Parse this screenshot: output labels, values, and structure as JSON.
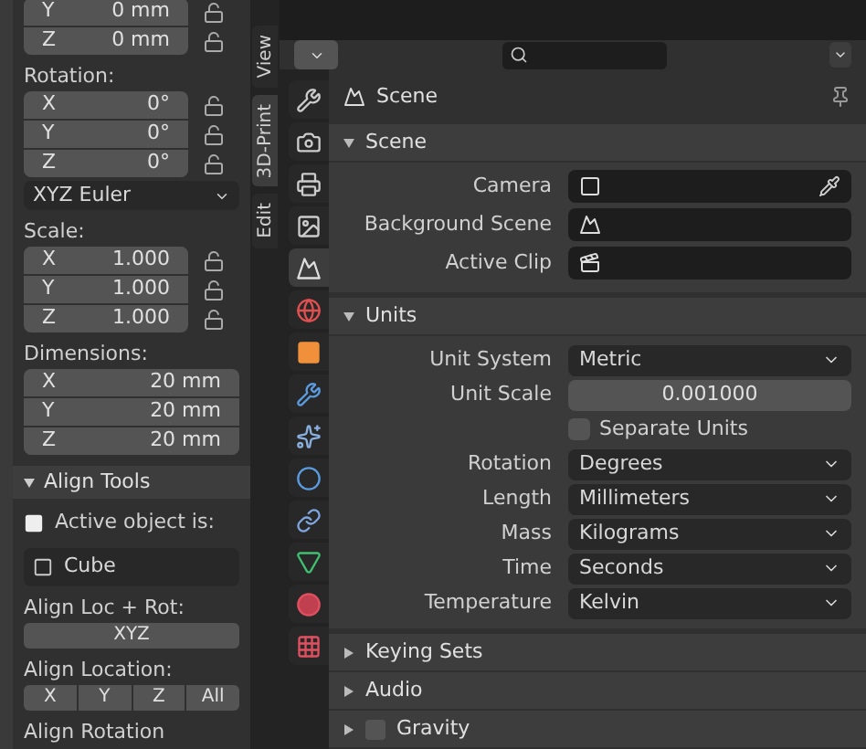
{
  "left_panel": {
    "location_rows": [
      {
        "axis": "Y",
        "value": "0 mm",
        "locked": false
      },
      {
        "axis": "Z",
        "value": "0 mm",
        "locked": false
      }
    ],
    "rotation": {
      "label": "Rotation:",
      "rows": [
        {
          "axis": "X",
          "value": "0°",
          "locked": false
        },
        {
          "axis": "Y",
          "value": "0°",
          "locked": false
        },
        {
          "axis": "Z",
          "value": "0°",
          "locked": false
        }
      ],
      "mode": "XYZ Euler"
    },
    "scale": {
      "label": "Scale:",
      "rows": [
        {
          "axis": "X",
          "value": "1.000",
          "locked": false
        },
        {
          "axis": "Y",
          "value": "1.000",
          "locked": false
        },
        {
          "axis": "Z",
          "value": "1.000",
          "locked": false
        }
      ]
    },
    "dimensions": {
      "label": "Dimensions:",
      "rows": [
        {
          "axis": "X",
          "value": "20 mm"
        },
        {
          "axis": "Y",
          "value": "20 mm"
        },
        {
          "axis": "Z",
          "value": "20 mm"
        }
      ]
    },
    "align_tools": {
      "title": "Align Tools",
      "expanded": true,
      "active_label": "Active object is:",
      "active_object": "Cube",
      "loc_rot_label": "Align Loc + Rot:",
      "loc_rot_button": "XYZ",
      "location_label": "Align Location:",
      "location_buttons": [
        "X",
        "Y",
        "Z",
        "All"
      ],
      "rotation_label": "Align Rotation"
    }
  },
  "side_tabs": [
    {
      "label": "View",
      "selected": false
    },
    {
      "label": "3D-Print",
      "selected": true
    },
    {
      "label": "Edit",
      "selected": false
    }
  ],
  "properties": {
    "tabs": [
      {
        "kind": "tool",
        "selected": false
      },
      {
        "kind": "render",
        "selected": false
      },
      {
        "kind": "output",
        "selected": false
      },
      {
        "kind": "view_layer",
        "selected": false
      },
      {
        "kind": "scene",
        "selected": true
      },
      {
        "kind": "world",
        "selected": false
      },
      {
        "kind": "object",
        "selected": false
      },
      {
        "kind": "modifiers",
        "selected": false
      },
      {
        "kind": "particles",
        "selected": false
      },
      {
        "kind": "physics",
        "selected": false
      },
      {
        "kind": "constraints",
        "selected": false
      },
      {
        "kind": "data",
        "selected": false
      },
      {
        "kind": "material",
        "selected": false
      },
      {
        "kind": "texture",
        "selected": false
      }
    ],
    "context": "Scene",
    "panels": [
      {
        "title": "Scene",
        "expanded": true,
        "rows": [
          {
            "kind": "camera_field",
            "label": "Camera"
          },
          {
            "kind": "scene_field",
            "label": "Background Scene"
          },
          {
            "kind": "clip_field",
            "label": "Active Clip"
          }
        ]
      },
      {
        "title": "Units",
        "expanded": true,
        "rows": [
          {
            "kind": "dropdown",
            "label": "Unit System",
            "value": "Metric"
          },
          {
            "kind": "number",
            "label": "Unit Scale",
            "value": "0.001000"
          },
          {
            "kind": "checkbox",
            "label": "Separate Units",
            "checked": false
          },
          {
            "kind": "dropdown",
            "label": "Rotation",
            "value": "Degrees"
          },
          {
            "kind": "dropdown",
            "label": "Length",
            "value": "Millimeters"
          },
          {
            "kind": "dropdown",
            "label": "Mass",
            "value": "Kilograms"
          },
          {
            "kind": "dropdown",
            "label": "Time",
            "value": "Seconds"
          },
          {
            "kind": "dropdown",
            "label": "Temperature",
            "value": "Kelvin"
          }
        ]
      },
      {
        "title": "Keying Sets",
        "expanded": false
      },
      {
        "title": "Audio",
        "expanded": false
      },
      {
        "title": "Gravity",
        "expanded": false,
        "toggle": false
      }
    ]
  }
}
